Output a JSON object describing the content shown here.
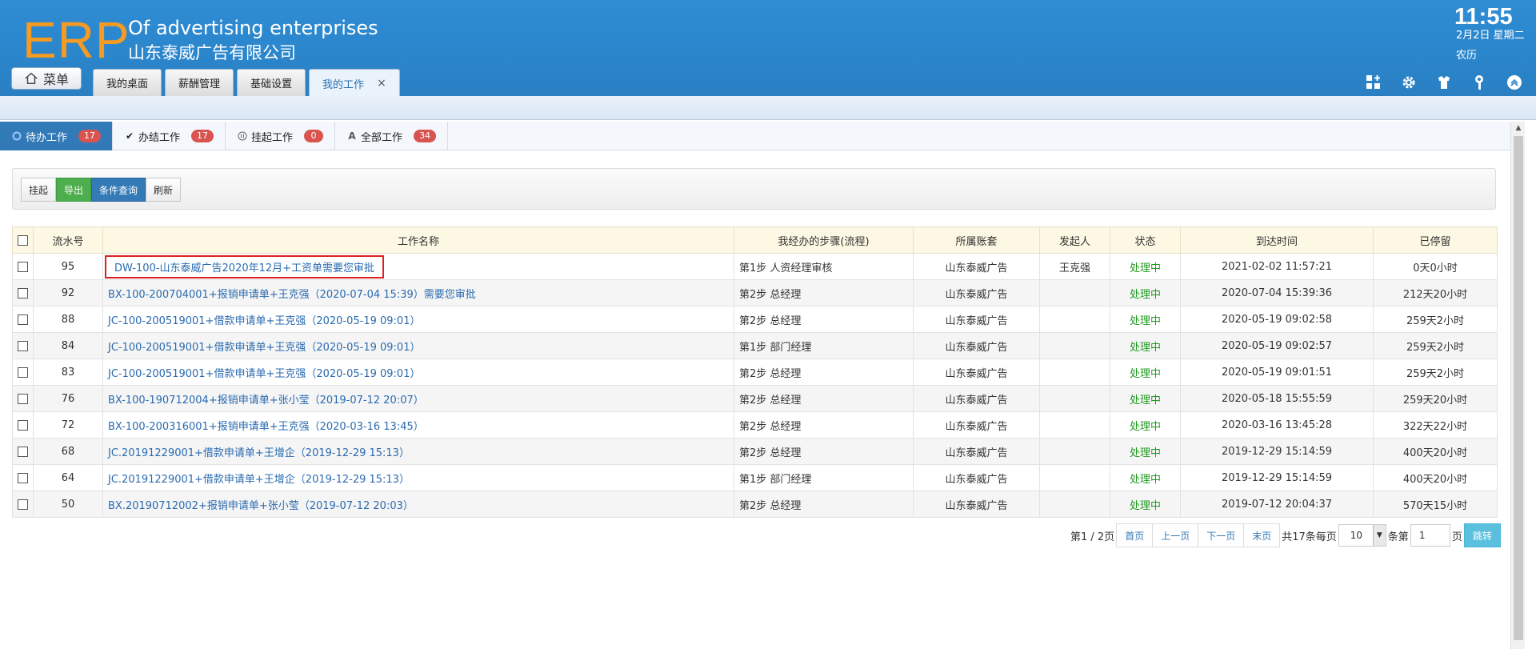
{
  "header": {
    "logo": "ERP",
    "company_en": "Of advertising enterprises",
    "company_cn": "山东泰威广告有限公司",
    "time": "11:55",
    "date": "2月2日 星期二",
    "lunar": "农历",
    "menu_label": "菜单",
    "tabs": [
      {
        "label": "我的桌面"
      },
      {
        "label": "薪酬管理"
      },
      {
        "label": "基础设置"
      },
      {
        "label": "我的工作",
        "close": "×"
      }
    ],
    "icons": [
      "grid-add-icon",
      "gear-icon",
      "shirt-icon",
      "key-icon",
      "collapse-up-icon"
    ]
  },
  "work_tabs": [
    {
      "label": "待办工作",
      "count": "17",
      "icon": "refresh-icon"
    },
    {
      "label": "办结工作",
      "count": "17",
      "icon": "check-icon"
    },
    {
      "label": "挂起工作",
      "count": "0",
      "icon": "pause-icon"
    },
    {
      "label": "全部工作",
      "count": "34",
      "icon": "font-a-icon"
    }
  ],
  "toolbar": {
    "suspend": "挂起",
    "export": "导出",
    "query": "条件查询",
    "refresh": "刷新"
  },
  "table": {
    "headers": {
      "serial": "流水号",
      "name": "工作名称",
      "step": "我经办的步骤(流程)",
      "account": "所属账套",
      "initiator": "发起人",
      "status": "状态",
      "arrival": "到达时间",
      "stay": "已停留"
    },
    "rows": [
      {
        "serial": "95",
        "name": "DW-100-山东泰威广告2020年12月+工资单需要您审批",
        "step": "第1步 人资经理审核",
        "account": "山东泰威广告",
        "initiator": "王克强",
        "status": "处理中",
        "arrival": "2021-02-02 11:57:21",
        "stay": "0天0小时"
      },
      {
        "serial": "92",
        "name": "BX-100-200704001+报销申请单+王克强（2020-07-04 15:39）需要您审批",
        "step": "第2步 总经理",
        "account": "山东泰威广告",
        "initiator": "",
        "status": "处理中",
        "arrival": "2020-07-04 15:39:36",
        "stay": "212天20小时"
      },
      {
        "serial": "88",
        "name": "JC-100-200519001+借款申请单+王克强（2020-05-19 09:01）",
        "step": "第2步 总经理",
        "account": "山东泰威广告",
        "initiator": "",
        "status": "处理中",
        "arrival": "2020-05-19 09:02:58",
        "stay": "259天2小时"
      },
      {
        "serial": "84",
        "name": "JC-100-200519001+借款申请单+王克强（2020-05-19 09:01）",
        "step": "第1步 部门经理",
        "account": "山东泰威广告",
        "initiator": "",
        "status": "处理中",
        "arrival": "2020-05-19 09:02:57",
        "stay": "259天2小时"
      },
      {
        "serial": "83",
        "name": "JC-100-200519001+借款申请单+王克强（2020-05-19 09:01）",
        "step": "第2步 总经理",
        "account": "山东泰威广告",
        "initiator": "",
        "status": "处理中",
        "arrival": "2020-05-19 09:01:51",
        "stay": "259天2小时"
      },
      {
        "serial": "76",
        "name": "BX-100-190712004+报销申请单+张小莹（2019-07-12 20:07）",
        "step": "第2步 总经理",
        "account": "山东泰威广告",
        "initiator": "",
        "status": "处理中",
        "arrival": "2020-05-18 15:55:59",
        "stay": "259天20小时"
      },
      {
        "serial": "72",
        "name": "BX-100-200316001+报销申请单+王克强（2020-03-16 13:45）",
        "step": "第2步 总经理",
        "account": "山东泰威广告",
        "initiator": "",
        "status": "处理中",
        "arrival": "2020-03-16 13:45:28",
        "stay": "322天22小时"
      },
      {
        "serial": "68",
        "name": "JC.20191229001+借款申请单+王增企（2019-12-29 15:13）",
        "step": "第2步 总经理",
        "account": "山东泰威广告",
        "initiator": "",
        "status": "处理中",
        "arrival": "2019-12-29 15:14:59",
        "stay": "400天20小时"
      },
      {
        "serial": "64",
        "name": "JC.20191229001+借款申请单+王增企（2019-12-29 15:13）",
        "step": "第1步 部门经理",
        "account": "山东泰威广告",
        "initiator": "",
        "status": "处理中",
        "arrival": "2019-12-29 15:14:59",
        "stay": "400天20小时"
      },
      {
        "serial": "50",
        "name": "BX.20190712002+报销申请单+张小莹（2019-07-12 20:03）",
        "step": "第2步 总经理",
        "account": "山东泰威广告",
        "initiator": "",
        "status": "处理中",
        "arrival": "2019-07-12 20:04:37",
        "stay": "570天15小时"
      }
    ]
  },
  "pagination": {
    "page_info": "第1 / 2页",
    "first": "首页",
    "prev": "上一页",
    "next": "下一页",
    "last": "末页",
    "total_text": "共17条每页",
    "page_size": "10",
    "per_page_suffix": "条第",
    "page_input": "1",
    "page_suffix": "页",
    "go": "跳转"
  },
  "colors": {
    "header_blue": "#2b86cc",
    "logo_orange": "#f59a23",
    "active_tab": "#3279b7",
    "badge_red": "#d9534f",
    "export_green": "#4cae4c",
    "status_green": "#1f9a1f",
    "highlight_red": "#e02020"
  }
}
